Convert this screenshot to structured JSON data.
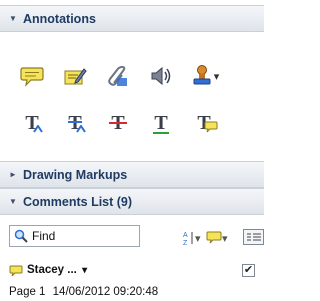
{
  "sections": {
    "annotations": {
      "caret": "▼",
      "label": "Annotations"
    },
    "drawing_markups": {
      "caret": "►",
      "label": "Drawing Markups"
    },
    "comments_list": {
      "caret": "▼",
      "label": "Comments List (9)"
    }
  },
  "tools": {
    "row1": [
      "sticky-note-icon",
      "highlight-text-icon",
      "attach-file-icon",
      "record-audio-icon",
      "stamp-icon"
    ],
    "row2": [
      "insert-text-icon",
      "replace-text-icon",
      "strikethrough-icon",
      "underline-icon",
      "text-comment-icon"
    ],
    "stamp_dropdown": "▾"
  },
  "comments": {
    "search": {
      "value": "Find"
    },
    "sort_dropdown": "▾",
    "filter_dropdown": "▾",
    "items": [
      {
        "author": "Stacey ...",
        "author_dropdown": "▾",
        "page": "Page 1",
        "timestamp": "14/06/2012 09:20:48",
        "checked": "✔"
      }
    ]
  },
  "colors": {
    "accent_blue": "#2f6fd6",
    "strike_red": "#d9282f",
    "underline_green": "#2e9e3e",
    "note_yellow": "#f7e35a"
  }
}
